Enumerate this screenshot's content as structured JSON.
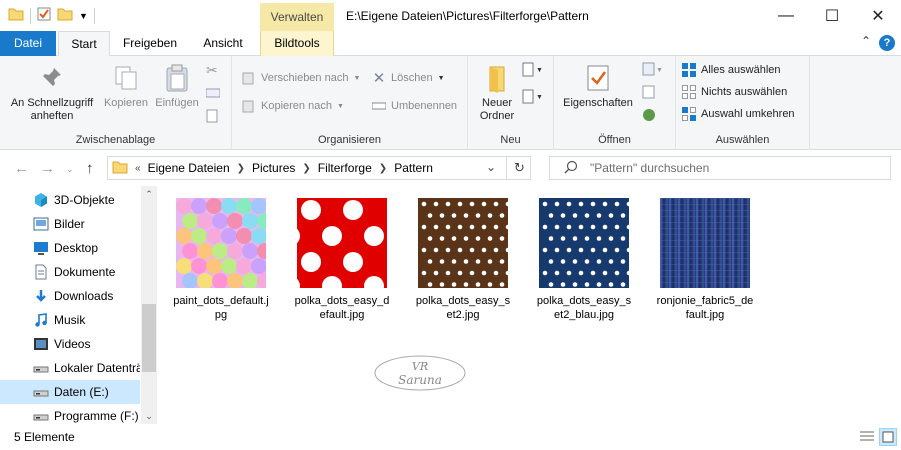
{
  "window": {
    "title": "E:\\Eigene Dateien\\Pictures\\Filterforge\\Pattern",
    "context_tab": "Verwalten"
  },
  "tabs": [
    "Datei",
    "Start",
    "Freigeben",
    "Ansicht",
    "Bildtools"
  ],
  "ribbon": {
    "clipboard": {
      "label": "Zwischenablage",
      "pin": "An Schnellzugriff anheften",
      "copy": "Kopieren",
      "paste": "Einfügen"
    },
    "organize": {
      "label": "Organisieren",
      "move_to": "Verschieben nach",
      "copy_to": "Kopieren nach",
      "delete": "Löschen",
      "rename": "Umbenennen"
    },
    "new": {
      "label": "Neu",
      "new_folder": "Neuer Ordner"
    },
    "open": {
      "label": "Öffnen",
      "properties": "Eigenschaften"
    },
    "select": {
      "label": "Auswählen",
      "select_all": "Alles auswählen",
      "select_none": "Nichts auswählen",
      "invert": "Auswahl umkehren"
    }
  },
  "breadcrumb": [
    "Eigene Dateien",
    "Pictures",
    "Filterforge",
    "Pattern"
  ],
  "search": {
    "placeholder": "\"Pattern\" durchsuchen"
  },
  "sidebar": {
    "items": [
      {
        "label": "3D-Objekte",
        "icon": "3d-objects-icon"
      },
      {
        "label": "Bilder",
        "icon": "pictures-icon"
      },
      {
        "label": "Desktop",
        "icon": "desktop-icon"
      },
      {
        "label": "Dokumente",
        "icon": "documents-icon"
      },
      {
        "label": "Downloads",
        "icon": "downloads-icon"
      },
      {
        "label": "Musik",
        "icon": "music-icon"
      },
      {
        "label": "Videos",
        "icon": "videos-icon"
      },
      {
        "label": "Lokaler Datenträger (C:)",
        "icon": "drive-icon"
      },
      {
        "label": "Daten (E:)",
        "icon": "drive-icon",
        "selected": true
      },
      {
        "label": "Programme (F:)",
        "icon": "drive-icon"
      }
    ]
  },
  "files": [
    {
      "name": "paint_dots_default.jpg",
      "pattern": "paint-dots"
    },
    {
      "name": "polka_dots_easy_default.jpg",
      "pattern": "polka-red"
    },
    {
      "name": "polka_dots_easy_set2.jpg",
      "pattern": "polka-brown"
    },
    {
      "name": "polka_dots_easy_set2_blau.jpg",
      "pattern": "polka-blue"
    },
    {
      "name": "ronjonie_fabric5_default.jpg",
      "pattern": "fabric"
    }
  ],
  "watermark": {
    "line1": "VR",
    "line2": "Saruna"
  },
  "status": {
    "count": "5 Elemente"
  },
  "colors": {
    "accent": "#1979ca",
    "selection": "#cce8ff",
    "context_tab": "#f6e9a8"
  }
}
